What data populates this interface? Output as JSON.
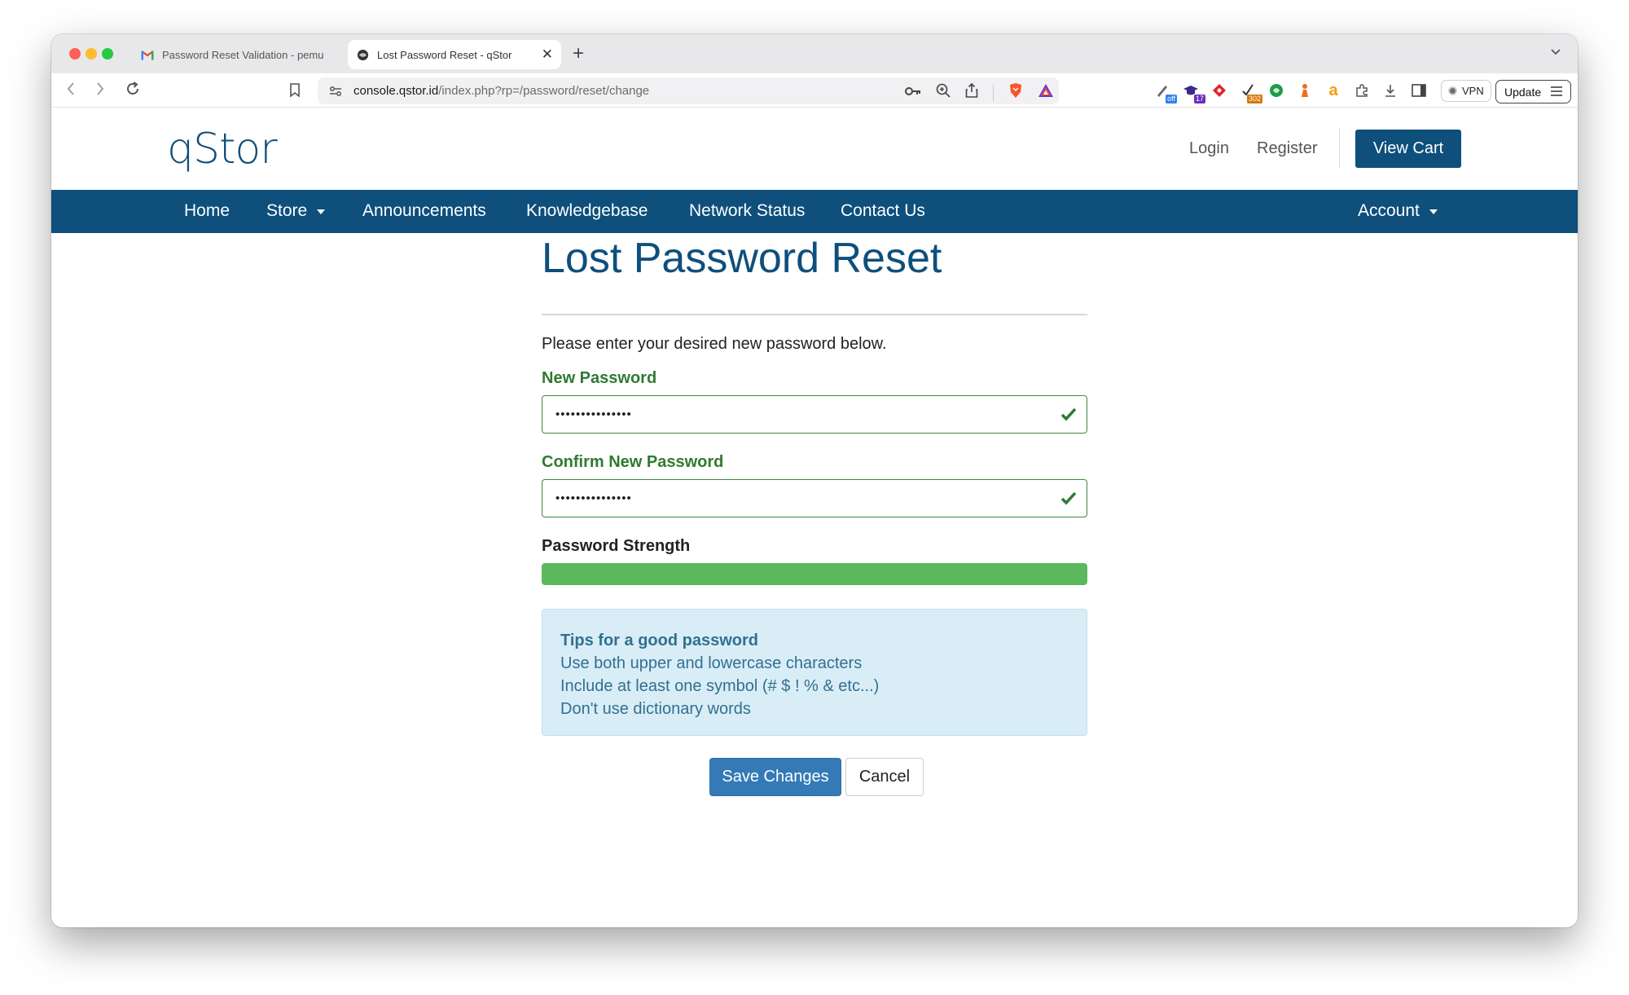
{
  "browser": {
    "tabs": [
      {
        "label": "Password Reset Validation - pemu",
        "icon": "gmail-icon",
        "active": false
      },
      {
        "label": "Lost Password Reset - qStor",
        "icon": "globe-icon",
        "active": true
      }
    ],
    "url": {
      "domain": "console.qstor.id",
      "path": "/index.php?rp=/password/reset/change"
    },
    "extensions": [
      {
        "icon": "pen-icon",
        "badge": "off",
        "badge_color": "#2f80ed"
      },
      {
        "icon": "graduation-cap-icon",
        "badge": "17",
        "badge_color": "#6b2fbf"
      },
      {
        "icon": "red-diamond-icon",
        "badge": ""
      },
      {
        "icon": "checkmark-icon",
        "badge": "302",
        "badge_color": "#d97706"
      },
      {
        "icon": "green-circle-icon",
        "badge": ""
      },
      {
        "icon": "chess-icon",
        "badge": ""
      },
      {
        "icon": "amazon-icon",
        "badge": ""
      },
      {
        "icon": "puzzle-icon",
        "badge": ""
      },
      {
        "icon": "download-icon",
        "badge": ""
      },
      {
        "icon": "sidebar-icon",
        "badge": ""
      }
    ],
    "vpn_label": "VPN",
    "update_label": "Update"
  },
  "header": {
    "brand": "qStor",
    "login": "Login",
    "register": "Register",
    "view_cart": "View Cart"
  },
  "nav": {
    "home": "Home",
    "store": "Store",
    "announcements": "Announcements",
    "knowledgebase": "Knowledgebase",
    "network_status": "Network Status",
    "contact_us": "Contact Us",
    "account": "Account"
  },
  "form": {
    "title": "Lost Password Reset",
    "intro": "Please enter your desired new password below.",
    "new_password_label": "New Password",
    "new_password_value": "•••••••••••••••",
    "confirm_password_label": "Confirm New Password",
    "confirm_password_value": "•••••••••••••••",
    "strength_label": "Password Strength",
    "strength_percent": 100,
    "tips_title": "Tips for a good password",
    "tips": [
      "Use both upper and lowercase characters",
      "Include at least one symbol (# $ ! % & etc...)",
      "Don't use dictionary words"
    ],
    "save_label": "Save Changes",
    "cancel_label": "Cancel"
  },
  "colors": {
    "brand_blue": "#0e4f7c",
    "valid_green": "#2f7a31",
    "strength_green": "#5cb85c",
    "tips_bg": "#d9edf7",
    "primary_button": "#337ab7"
  }
}
